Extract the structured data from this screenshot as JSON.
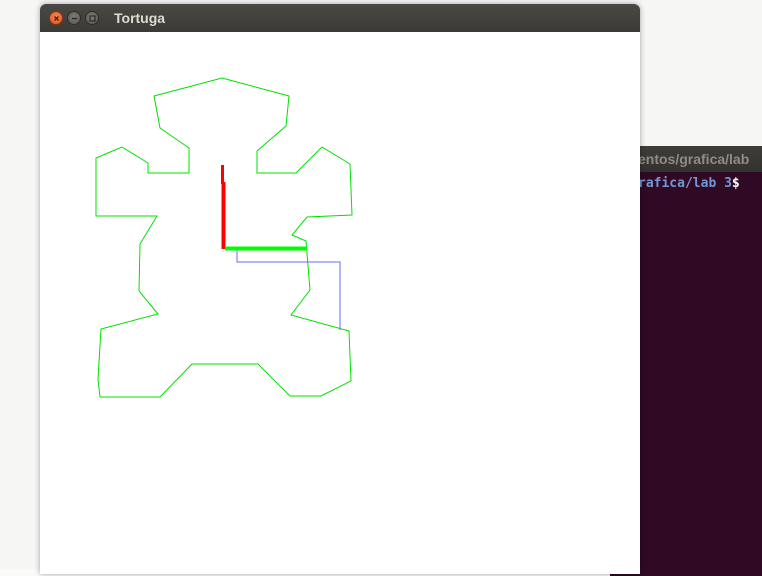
{
  "window": {
    "title": "Tortuga",
    "buttons": [
      "close",
      "minimize",
      "maximize"
    ]
  },
  "terminal": {
    "title": "entos/grafica/lab",
    "prompt_path": "rafica/lab 3",
    "prompt_symbol": "$"
  },
  "colors": {
    "outline": "#00e000",
    "axis_y": "#ff0000",
    "axis_x": "#00ff00",
    "path": "#6a6aff",
    "terminal_bg": "#300a24",
    "titlebar": "#3c3b37"
  },
  "icons": {
    "close": "close-icon",
    "minimize": "minimize-icon",
    "maximize": "maximize-icon"
  }
}
